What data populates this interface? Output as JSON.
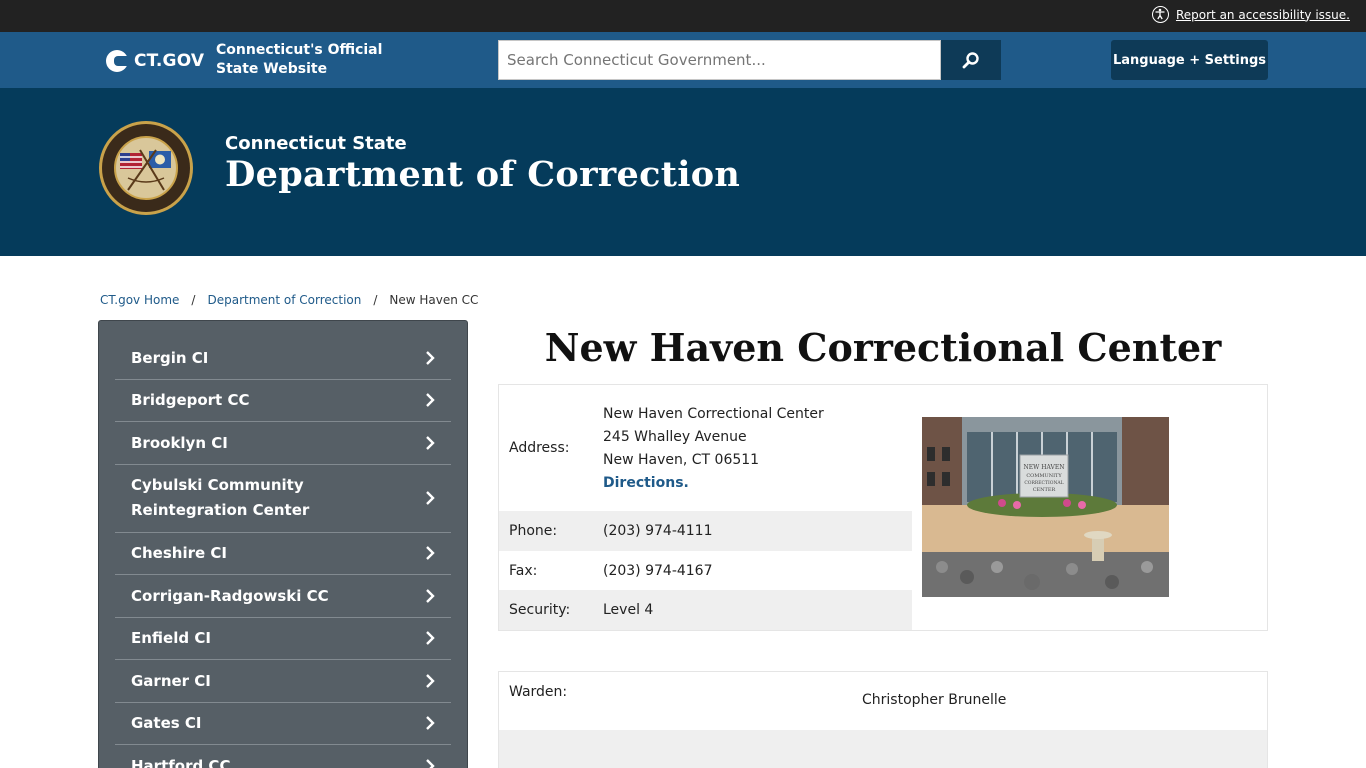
{
  "utility": {
    "accessibility_link": "Report an accessibility issue."
  },
  "global_header": {
    "logo_text": "CT.GOV",
    "tagline_line1": "Connecticut's Official",
    "tagline_line2": "State Website",
    "search_placeholder": "Search Connecticut Government...",
    "language_button": "Language + Settings"
  },
  "agency": {
    "subtitle": "Connecticut State",
    "title": "Department of Correction"
  },
  "breadcrumb": {
    "home": "CT.gov Home",
    "separator": "/",
    "agency": "Department of Correction",
    "current": "New Haven CC"
  },
  "sidebar": {
    "items": [
      {
        "label": "Bergin CI"
      },
      {
        "label": "Bridgeport CC"
      },
      {
        "label": "Brooklyn CI"
      },
      {
        "label": "Cybulski Community Reintegration Center"
      },
      {
        "label": "Cheshire CI"
      },
      {
        "label": "Corrigan-Radgowski CC"
      },
      {
        "label": "Enfield CI"
      },
      {
        "label": "Garner CI"
      },
      {
        "label": "Gates CI"
      },
      {
        "label": "Hartford CC"
      }
    ]
  },
  "main": {
    "title": "New Haven Correctional Center",
    "address_label": "Address:",
    "address_line1": "New Haven Correctional Center",
    "address_line2": "245 Whalley Avenue",
    "address_line3": "New Haven, CT 06511",
    "directions_link": "Directions.",
    "phone_label": "Phone:",
    "phone_value": "(203) 974-4111",
    "fax_label": "Fax:",
    "fax_value": "(203) 974-4167",
    "security_label": "Security:",
    "security_value": "Level 4",
    "photo_sign_text": "NEW HAVEN COMMUNITY CORRECTIONAL CENTER",
    "warden_label": "Warden:",
    "warden_value": "Christopher Brunelle"
  },
  "colors": {
    "utility_bar": "#222222",
    "global_header": "#1f5a89",
    "agency_banner": "#053b5b",
    "dark_button": "#0e3a57",
    "sidebar": "#565f66",
    "link": "#1f5a89"
  }
}
